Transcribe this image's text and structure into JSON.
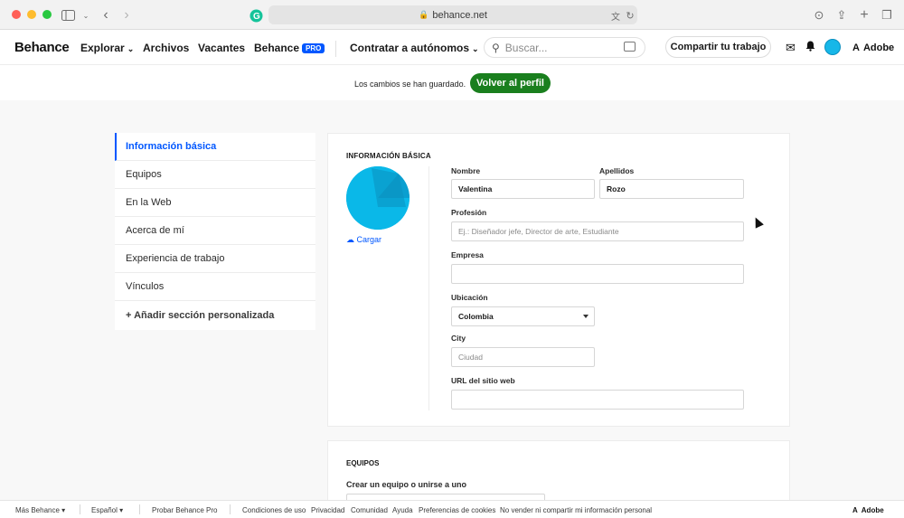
{
  "browser": {
    "url": "behance.net"
  },
  "header": {
    "logo": "Behance",
    "nav": {
      "explore": "Explorar",
      "files": "Archivos",
      "jobs": "Vacantes",
      "behance": "Behance",
      "pro_badge": "PRO",
      "hire": "Contratar a autónomos"
    },
    "search_placeholder": "Buscar...",
    "share_button": "Compartir tu trabajo",
    "adobe": "Adobe"
  },
  "notice": {
    "text": "Los cambios se han guardado.",
    "back_button": "Volver al perfil"
  },
  "sidebar": {
    "items": [
      {
        "label": "Información básica"
      },
      {
        "label": "Equipos"
      },
      {
        "label": "En la Web"
      },
      {
        "label": "Acerca de mí"
      },
      {
        "label": "Experiencia de trabajo"
      },
      {
        "label": "Vínculos"
      },
      {
        "label": "+ Añadir sección personalizada"
      }
    ]
  },
  "basic_info": {
    "title": "INFORMACIÓN BÁSICA",
    "upload_label": "Cargar",
    "first_name": {
      "label": "Nombre",
      "value": "Valentina"
    },
    "last_name": {
      "label": "Apellidos",
      "value": "Rozo"
    },
    "profession": {
      "label": "Profesión",
      "placeholder": "Ej.: Diseñador jefe, Director de arte, Estudiante"
    },
    "company": {
      "label": "Empresa",
      "value": ""
    },
    "location": {
      "label": "Ubicación",
      "value": "Colombia"
    },
    "city": {
      "label": "City",
      "placeholder": "Ciudad"
    },
    "website": {
      "label": "URL del sitio web",
      "value": ""
    }
  },
  "teams": {
    "title": "EQUIPOS",
    "create_label": "Crear un equipo o unirse a uno"
  },
  "footer": {
    "more": "Más Behance",
    "language": "Español",
    "pro_trial": "Probar Behance Pro",
    "terms": "Condiciones de uso",
    "privacy": "Privacidad",
    "community": "Comunidad",
    "help": "Ayuda",
    "cookies": "Preferencias de cookies",
    "do_not_sell": "No vender ni compartir mi información personal",
    "adobe": "Adobe"
  },
  "colors": {
    "accent_blue": "#0057ff",
    "save_green": "#1a7f1e",
    "avatar_cyan": "#0ab8e8"
  }
}
